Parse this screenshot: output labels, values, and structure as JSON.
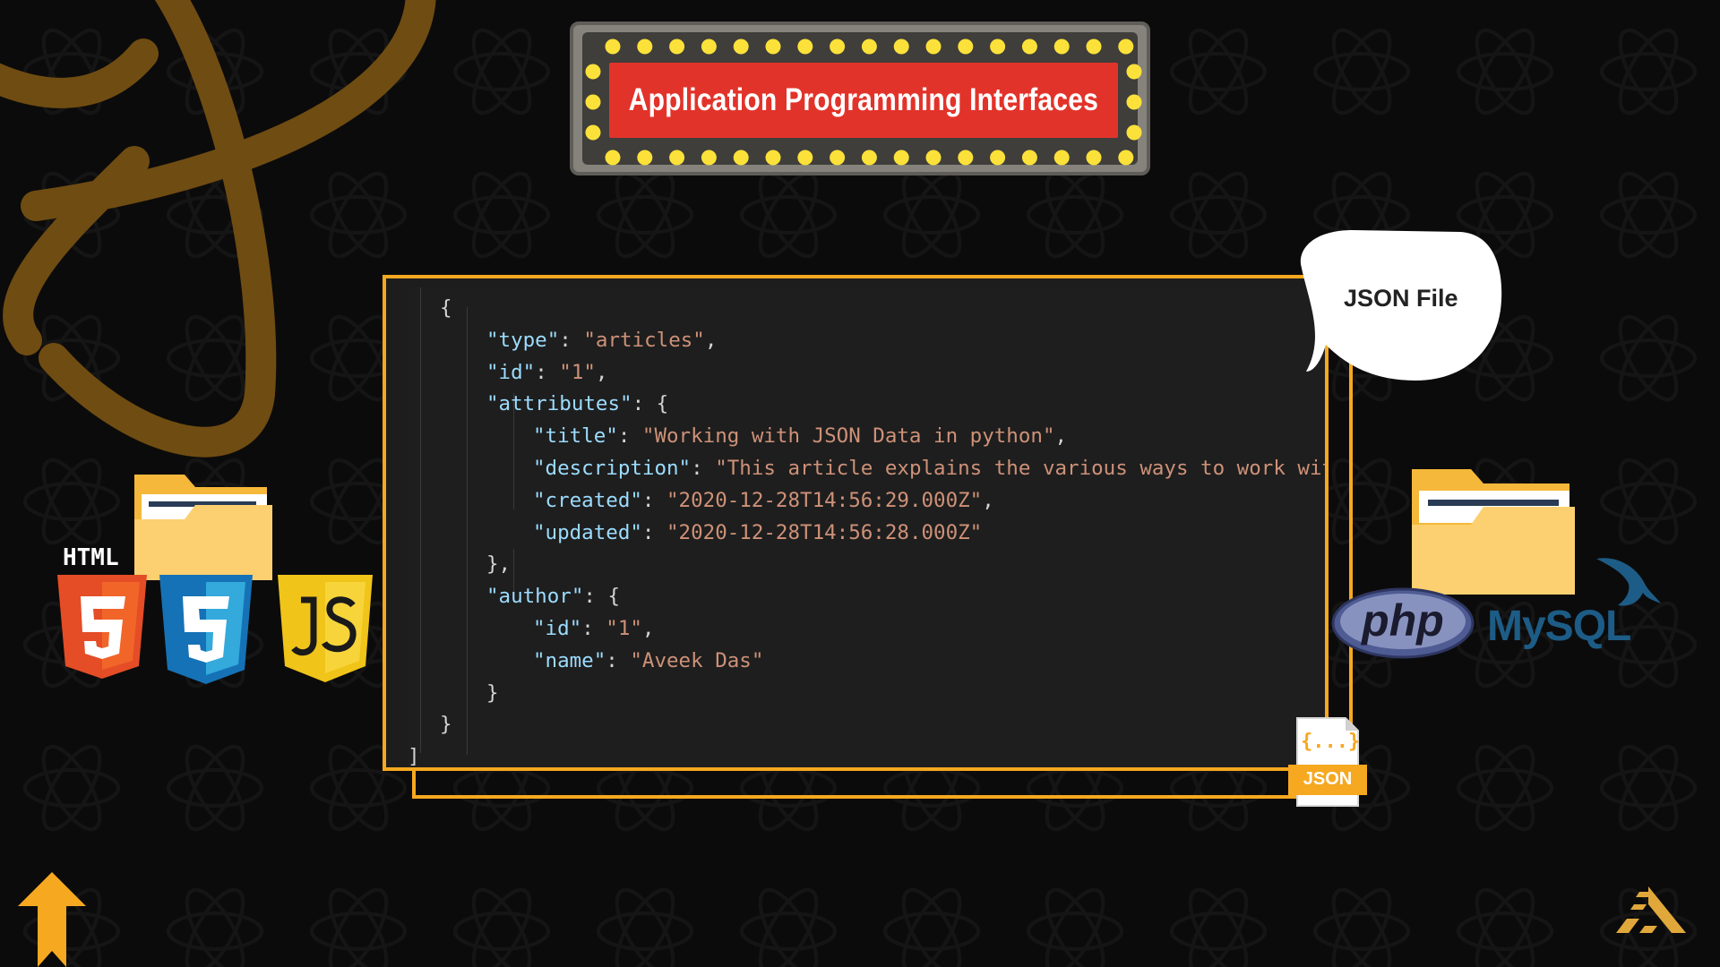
{
  "banner": {
    "title": "Application Programming Interfaces"
  },
  "code": {
    "lines": [
      [
        {
          "t": "{",
          "c": "p"
        }
      ],
      [
        {
          "t": "\"type\"",
          "c": "k"
        },
        {
          "t": ": ",
          "c": "p"
        },
        {
          "t": "\"articles\"",
          "c": "s"
        },
        {
          "t": ",",
          "c": "p"
        }
      ],
      [
        {
          "t": "\"id\"",
          "c": "k"
        },
        {
          "t": ": ",
          "c": "p"
        },
        {
          "t": "\"1\"",
          "c": "s"
        },
        {
          "t": ",",
          "c": "p"
        }
      ],
      [
        {
          "t": "\"attributes\"",
          "c": "k"
        },
        {
          "t": ": {",
          "c": "p"
        }
      ],
      [
        {
          "t": "\"title\"",
          "c": "k"
        },
        {
          "t": ": ",
          "c": "p"
        },
        {
          "t": "\"Working with JSON Data in python\"",
          "c": "s"
        },
        {
          "t": ",",
          "c": "p"
        }
      ],
      [
        {
          "t": "\"description\"",
          "c": "k"
        },
        {
          "t": ": ",
          "c": "p"
        },
        {
          "t": "\"This article explains the various ways to work wit",
          "c": "s"
        }
      ],
      [
        {
          "t": "\"created\"",
          "c": "k"
        },
        {
          "t": ": ",
          "c": "p"
        },
        {
          "t": "\"2020-12-28T14:56:29.000Z\"",
          "c": "s"
        },
        {
          "t": ",",
          "c": "p"
        }
      ],
      [
        {
          "t": "\"updated\"",
          "c": "k"
        },
        {
          "t": ": ",
          "c": "p"
        },
        {
          "t": "\"2020-12-28T14:56:28.000Z\"",
          "c": "s"
        }
      ],
      [
        {
          "t": "},",
          "c": "p"
        }
      ],
      [
        {
          "t": "\"author\"",
          "c": "k"
        },
        {
          "t": ": {",
          "c": "p"
        }
      ],
      [
        {
          "t": "\"id\"",
          "c": "k"
        },
        {
          "t": ": ",
          "c": "p"
        },
        {
          "t": "\"1\"",
          "c": "s"
        },
        {
          "t": ",",
          "c": "p"
        }
      ],
      [
        {
          "t": "\"name\"",
          "c": "k"
        },
        {
          "t": ": ",
          "c": "p"
        },
        {
          "t": "\"Aveek Das\"",
          "c": "s"
        }
      ],
      [
        {
          "t": "}",
          "c": "p"
        }
      ],
      [
        {
          "t": "}",
          "c": "p"
        }
      ],
      [
        {
          "t": "]",
          "c": "p"
        }
      ]
    ]
  },
  "bubble": {
    "label": "JSON File"
  },
  "json_badge": {
    "braces": "{...}",
    "label": "JSON"
  },
  "tech_left": {
    "html_label": "HTML",
    "css_label": "CSS"
  },
  "tech_right": {
    "php_label": "php",
    "mysql_label": "MySQL"
  },
  "colors": {
    "accent": "#f6a820",
    "banner_red": "#e2332a",
    "background": "#0c0b0b",
    "json_key": "#9cdcfe",
    "json_string": "#ce9178"
  }
}
